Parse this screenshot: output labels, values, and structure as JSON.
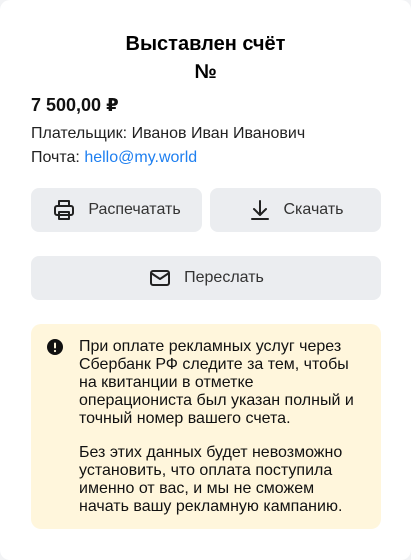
{
  "invoice": {
    "title_line1": "Выставлен счёт",
    "title_line2": "№",
    "amount": "7 500,00 ₽",
    "payer_label": "Плательщик:",
    "payer_name": "Иванов Иван Иванович",
    "email_label": "Почта:",
    "email": "hello@my.world"
  },
  "actions": {
    "print_label": "Распечатать",
    "download_label": "Скачать",
    "forward_label": "Переслать"
  },
  "notice": {
    "paragraph1": "При оплате рекламных услуг через Сбербанк РФ следите за тем, чтобы на квитанции в отметке операциониста был указан полный и точный номер вашего счета.",
    "paragraph2": "Без этих данных будет невозможно установить, что оплата поступила именно от вас, и мы не сможем начать вашу рекламную кампанию."
  },
  "icons": {
    "print": "printer-icon",
    "download": "download-icon",
    "forward": "mail-icon",
    "warning": "exclamation-circle-icon"
  },
  "colors": {
    "link": "#1e7ff0",
    "button_bg": "#ebedf0",
    "notice_bg": "#fff6dc"
  }
}
